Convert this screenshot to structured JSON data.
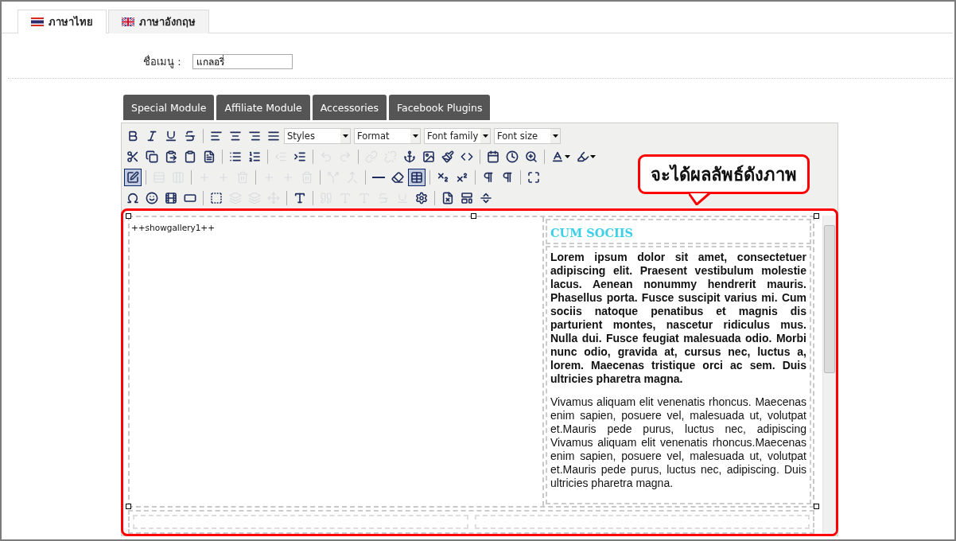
{
  "tabs": [
    {
      "label": "ภาษาไทย",
      "selected": true
    },
    {
      "label": "ภาษาอังกฤษ",
      "selected": false
    }
  ],
  "menu_name": {
    "label": "ชื่อเมนู :",
    "value": "แกลอรี่"
  },
  "module_buttons": [
    "Special Module",
    "Affiliate Module",
    "Accessories",
    "Facebook Plugins"
  ],
  "toolbar": [
    [
      {
        "kind": "button",
        "disabled": false,
        "selected": false
      },
      {
        "kind": "button",
        "disabled": false,
        "selected": false
      },
      {
        "kind": "button",
        "disabled": false,
        "selected": false
      },
      {
        "kind": "button",
        "disabled": false,
        "selected": false
      },
      {
        "kind": "separator"
      },
      {
        "kind": "button",
        "disabled": false,
        "selected": false
      },
      {
        "kind": "button",
        "disabled": false,
        "selected": false
      },
      {
        "kind": "button",
        "disabled": false,
        "selected": false
      },
      {
        "kind": "button",
        "disabled": false,
        "selected": false
      },
      {
        "kind": "dropdown",
        "label": "Styles"
      },
      {
        "kind": "dropdown",
        "label": "Format"
      },
      {
        "kind": "dropdown",
        "label": "Font family"
      },
      {
        "kind": "dropdown",
        "label": "Font size"
      }
    ],
    [
      {
        "kind": "button",
        "disabled": false,
        "selected": false
      },
      {
        "kind": "button",
        "disabled": false,
        "selected": false
      },
      {
        "kind": "button",
        "disabled": false,
        "selected": false
      },
      {
        "kind": "button",
        "disabled": false,
        "selected": false
      },
      {
        "kind": "button",
        "disabled": false,
        "selected": false
      },
      {
        "kind": "separator"
      },
      {
        "kind": "button",
        "disabled": false,
        "selected": false
      },
      {
        "kind": "button",
        "disabled": false,
        "selected": false
      },
      {
        "kind": "separator"
      },
      {
        "kind": "button",
        "disabled": true,
        "selected": false
      },
      {
        "kind": "button",
        "disabled": false,
        "selected": false
      },
      {
        "kind": "separator"
      },
      {
        "kind": "button",
        "disabled": true,
        "selected": false
      },
      {
        "kind": "button",
        "disabled": true,
        "selected": false
      },
      {
        "kind": "separator"
      },
      {
        "kind": "button",
        "disabled": true,
        "selected": false
      },
      {
        "kind": "button",
        "disabled": true,
        "selected": false
      },
      {
        "kind": "button",
        "disabled": false,
        "selected": false
      },
      {
        "kind": "button",
        "disabled": false,
        "selected": false
      },
      {
        "kind": "button",
        "disabled": false,
        "selected": false
      },
      {
        "kind": "button",
        "disabled": false,
        "selected": false
      },
      {
        "kind": "separator"
      },
      {
        "kind": "button",
        "disabled": false,
        "selected": false
      },
      {
        "kind": "button",
        "disabled": false,
        "selected": false
      },
      {
        "kind": "button",
        "disabled": false,
        "selected": false
      },
      {
        "kind": "separator"
      },
      {
        "kind": "split",
        "disabled": false,
        "selected": false
      },
      {
        "kind": "split",
        "disabled": false,
        "selected": false
      }
    ],
    [
      {
        "kind": "button",
        "disabled": false,
        "selected": true
      },
      {
        "kind": "separator"
      },
      {
        "kind": "button",
        "disabled": true,
        "selected": false
      },
      {
        "kind": "button",
        "disabled": true,
        "selected": false
      },
      {
        "kind": "separator"
      },
      {
        "kind": "button",
        "disabled": true,
        "selected": false
      },
      {
        "kind": "button",
        "disabled": true,
        "selected": false
      },
      {
        "kind": "button",
        "disabled": true,
        "selected": false
      },
      {
        "kind": "separator"
      },
      {
        "kind": "button",
        "disabled": true,
        "selected": false
      },
      {
        "kind": "button",
        "disabled": true,
        "selected": false
      },
      {
        "kind": "button",
        "disabled": true,
        "selected": false
      },
      {
        "kind": "separator"
      },
      {
        "kind": "button",
        "disabled": true,
        "selected": false
      },
      {
        "kind": "button",
        "disabled": true,
        "selected": false
      },
      {
        "kind": "separator"
      },
      {
        "kind": "button",
        "disabled": false,
        "selected": false
      },
      {
        "kind": "button",
        "disabled": false,
        "selected": false
      },
      {
        "kind": "button",
        "disabled": false,
        "selected": true
      },
      {
        "kind": "separator"
      },
      {
        "kind": "button",
        "disabled": false,
        "selected": false
      },
      {
        "kind": "button",
        "disabled": false,
        "selected": false
      },
      {
        "kind": "separator"
      },
      {
        "kind": "button",
        "disabled": false,
        "selected": false
      },
      {
        "kind": "button",
        "disabled": false,
        "selected": false
      },
      {
        "kind": "separator"
      },
      {
        "kind": "button",
        "disabled": false,
        "selected": false
      }
    ],
    [
      {
        "kind": "button",
        "disabled": false,
        "selected": false
      },
      {
        "kind": "button",
        "disabled": false,
        "selected": false
      },
      {
        "kind": "button",
        "disabled": false,
        "selected": false
      },
      {
        "kind": "button",
        "disabled": false,
        "selected": false
      },
      {
        "kind": "separator"
      },
      {
        "kind": "button",
        "disabled": false,
        "selected": false
      },
      {
        "kind": "button",
        "disabled": true,
        "selected": false
      },
      {
        "kind": "button",
        "disabled": true,
        "selected": false
      },
      {
        "kind": "button",
        "disabled": true,
        "selected": false
      },
      {
        "kind": "separator"
      },
      {
        "kind": "button",
        "disabled": false,
        "selected": false
      },
      {
        "kind": "separator"
      },
      {
        "kind": "button",
        "disabled": true,
        "selected": false
      },
      {
        "kind": "button",
        "disabled": true,
        "selected": false
      },
      {
        "kind": "button",
        "disabled": true,
        "selected": false
      },
      {
        "kind": "button",
        "disabled": true,
        "selected": false
      },
      {
        "kind": "button",
        "disabled": true,
        "selected": false
      },
      {
        "kind": "button",
        "disabled": false,
        "selected": false
      },
      {
        "kind": "separator"
      },
      {
        "kind": "button",
        "disabled": false,
        "selected": false
      },
      {
        "kind": "button",
        "disabled": false,
        "selected": false
      },
      {
        "kind": "button",
        "disabled": false,
        "selected": false
      }
    ]
  ],
  "editor": {
    "gallery_tag": "++showgallery1++",
    "heading": "CUM SOCIIS",
    "paragraphs": [
      {
        "bold": true,
        "text": "Lorem ipsum dolor sit amet, consectetuer adipiscing elit. Praesent vestibulum molestie lacus. Aenean nonummy hendrerit mauris. Phasellus porta. Fusce suscipit varius mi. Cum sociis natoque penatibus et magnis dis parturient montes, nascetur ridiculus mus. Nulla dui. Fusce feugiat malesuada odio. Morbi nunc odio, gravida at, cursus nec, luctus a, lorem. Maecenas tristique orci ac sem. Duis ultricies pharetra magna."
      },
      {
        "bold": false,
        "text": "Vivamus aliquam elit venenatis rhoncus. Maecenas enim sapien, posuere vel, malesuada ut, volutpat et.Mauris pede purus, luctus nec, adipiscing Vivamus aliquam elit venenatis rhoncus.Maecenas enim sapien, posuere vel, malesuada ut, volutpat et.Mauris pede purus, luctus nec, adipiscing. Duis ultricies pharetra magna."
      }
    ]
  },
  "callout": {
    "text": "จะได้ผลลัพธ์ดังภาพ"
  }
}
